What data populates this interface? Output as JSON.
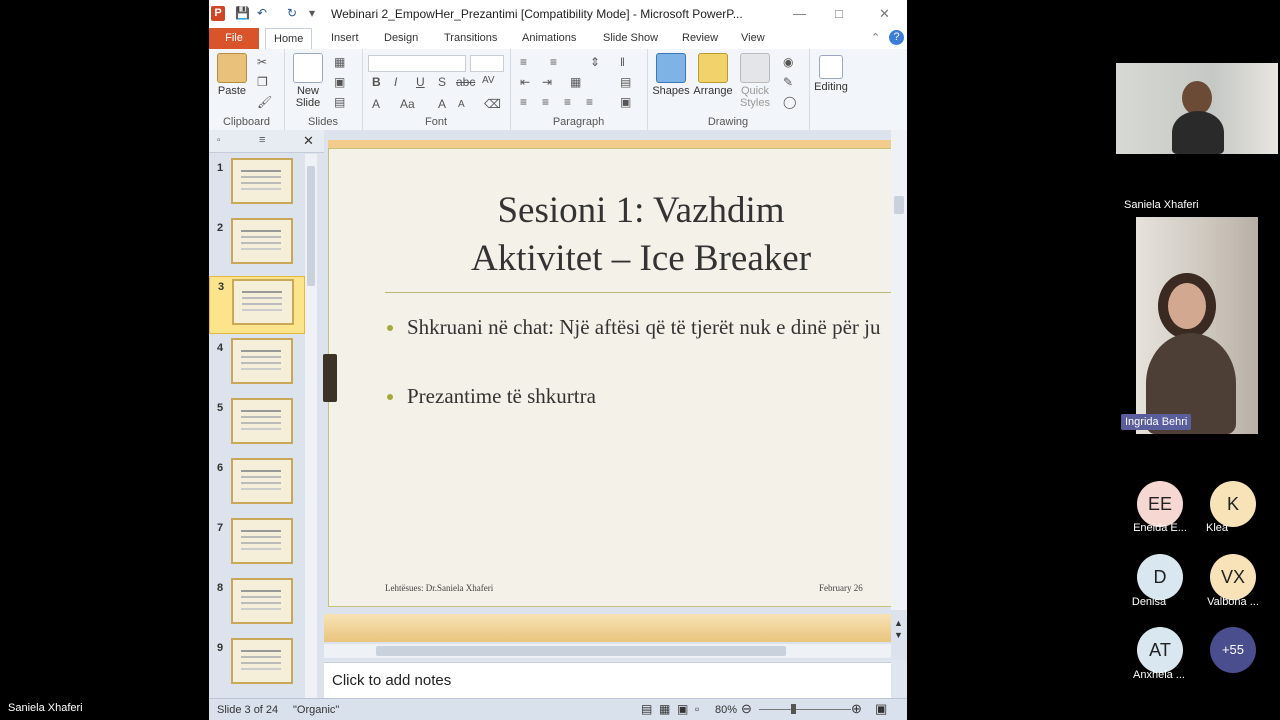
{
  "window": {
    "app_icon": "P",
    "title": "Webinari 2_EmpowHer_Prezantimi [Compatibility Mode]  -  Microsoft PowerP...",
    "controls": {
      "minimize": "—",
      "maximize": "□",
      "close": "✕"
    }
  },
  "ribbon_tabs": [
    "File",
    "Home",
    "Insert",
    "Design",
    "Transitions",
    "Animations",
    "Slide Show",
    "Review",
    "View"
  ],
  "ribbon": {
    "clipboard": {
      "paste": "Paste",
      "label": "Clipboard"
    },
    "slides": {
      "new_slide": "New Slide",
      "label": "Slides"
    },
    "font": {
      "label": "Font",
      "bold": "B",
      "italic": "I",
      "underline": "U",
      "shadow": "S",
      "strike": "abc",
      "spacing": "AV",
      "color": "A",
      "case": "Aa",
      "grow": "A",
      "shrink": "A"
    },
    "paragraph": {
      "label": "Paragraph"
    },
    "drawing": {
      "shapes": "Shapes",
      "arrange": "Arrange",
      "quick_styles": "Quick Styles",
      "label": "Drawing"
    },
    "editing": {
      "label": "Editing"
    }
  },
  "slide_thumbnails": [
    "1",
    "2",
    "3",
    "4",
    "5",
    "6",
    "7",
    "8",
    "9"
  ],
  "selected_slide": "3",
  "slide": {
    "title_line1": "Sesioni 1: Vazhdim",
    "title_line2": "Aktivitet – Ice Breaker",
    "bullets": [
      "Shkruani në chat: Një aftësi që të tjerët nuk e dinë për ju",
      "Prezantime të shkurtra"
    ],
    "footer_left": "Lehtësues: Dr.Saniela Xhaferi",
    "footer_right": "February 26"
  },
  "notes_placeholder": "Click to add notes",
  "status": {
    "slide_info": "Slide 3 of 24",
    "theme": "\"Organic\"",
    "zoom": "80%"
  },
  "meeting": {
    "presenter_label": "Saniela Xhaferi",
    "speaker_tag": "Ingrida Behri",
    "bottom_left_name": "Saniela Xhaferi",
    "participants": [
      {
        "initials": "EE",
        "name": "Eneida E...",
        "color": "#f6d7d2"
      },
      {
        "initials": "K",
        "name": "Klea",
        "color": "#f8e3b9"
      },
      {
        "initials": "D",
        "name": "Denisa",
        "color": "#d9e7f0"
      },
      {
        "initials": "VX",
        "name": "Valbona ...",
        "color": "#f8e3b9"
      },
      {
        "initials": "AT",
        "name": "Anxhela ...",
        "color": "#d9e7f0"
      },
      {
        "initials": "+55",
        "name": "",
        "color": "#4a4e8f"
      }
    ]
  }
}
